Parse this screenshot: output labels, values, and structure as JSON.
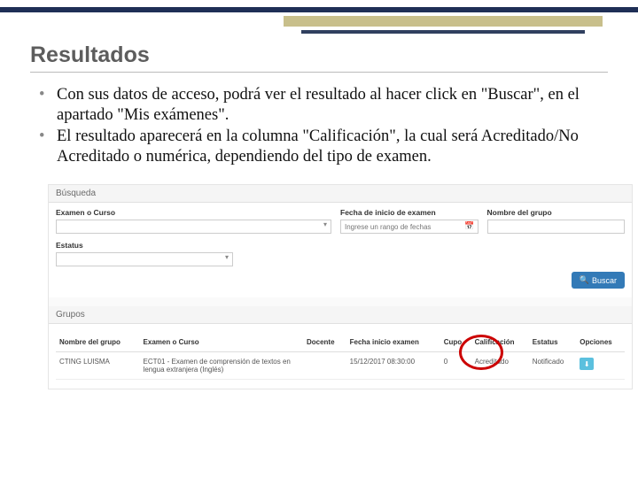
{
  "slide": {
    "title": "Resultados",
    "bullets": [
      "Con sus datos de acceso, podrá ver el resultado al hacer click en \"Buscar\", en el apartado \"Mis exámenes\".",
      "El resultado aparecerá en la columna \"Calificación\", la cual será Acreditado/No Acreditado o numérica, dependiendo del tipo de examen."
    ]
  },
  "search_panel": {
    "heading": "Búsqueda",
    "fields": {
      "examen": {
        "label": "Examen o Curso"
      },
      "fecha": {
        "label": "Fecha de inicio de examen",
        "placeholder": "Ingrese un rango de fechas"
      },
      "grupo": {
        "label": "Nombre del grupo"
      },
      "estatus": {
        "label": "Estatus"
      }
    },
    "buscar": "Buscar"
  },
  "grupos_panel": {
    "heading": "Grupos",
    "columns": {
      "nombre": "Nombre del grupo",
      "examen": "Examen o Curso",
      "docente": "Docente",
      "fecha": "Fecha inicio examen",
      "cupo": "Cupo",
      "calif": "Calificación",
      "estatus": "Estatus",
      "opciones": "Opciones"
    },
    "row": {
      "nombre": "CTING LUISMA",
      "examen": "ECT01 - Examen de comprensión de textos en lengua extranjera (Inglés)",
      "docente": "",
      "fecha": "15/12/2017 08:30:00",
      "cupo": "0",
      "calif": "Acreditado",
      "estatus": "Notificado"
    }
  }
}
